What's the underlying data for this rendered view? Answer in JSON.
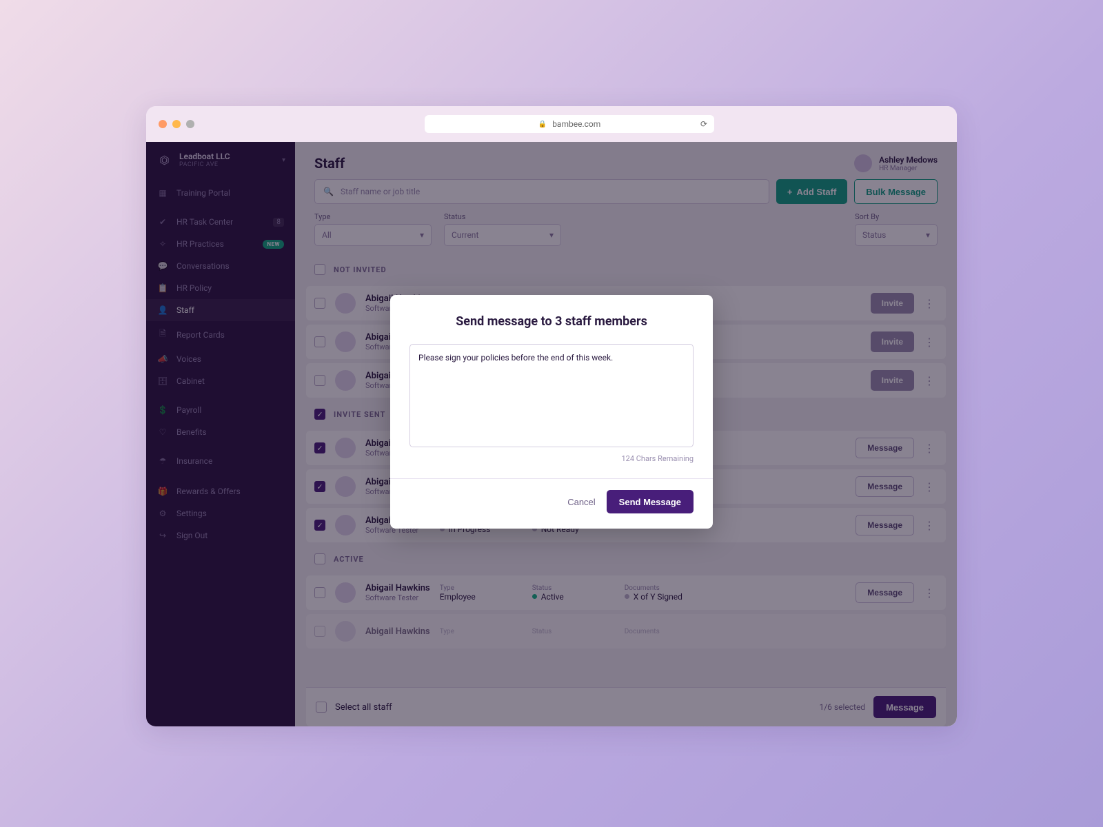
{
  "browser": {
    "url": "bambee.com"
  },
  "org": {
    "name": "Leadboat LLC",
    "sub": "PACIFIC AVE"
  },
  "nav": {
    "training": "Training Portal",
    "taskcenter": "HR Task Center",
    "taskcenter_badge": "8",
    "practices": "HR Practices",
    "practices_badge": "NEW",
    "conversations": "Conversations",
    "policy": "HR Policy",
    "staff": "Staff",
    "reportcards": "Report Cards",
    "voices": "Voices",
    "cabinet": "Cabinet",
    "payroll": "Payroll",
    "benefits": "Benefits",
    "insurance": "Insurance",
    "rewards": "Rewards & Offers",
    "settings": "Settings",
    "signout": "Sign Out"
  },
  "header": {
    "title": "Staff",
    "user_name": "Ashley Medows",
    "user_role": "HR Manager"
  },
  "toolbar": {
    "search_placeholder": "Staff name or job title",
    "add_staff": "Add Staff",
    "bulk_message": "Bulk Message"
  },
  "filters": {
    "type_label": "Type",
    "type_value": "All",
    "status_label": "Status",
    "status_value": "Current",
    "sort_label": "Sort By",
    "sort_value": "Status"
  },
  "sections": {
    "not_invited": "NOT INVITED",
    "invite_sent": "INVITE SENT",
    "active": "ACTIVE"
  },
  "labels": {
    "status": "Status",
    "documents": "Documents",
    "type": "Type",
    "invite": "Invite",
    "message": "Message",
    "in_progress": "In Progress",
    "not_ready": "Not Ready",
    "employee": "Employee",
    "active_val": "Active",
    "signed": "X of Y Signed"
  },
  "staff": {
    "name": "Abigail Hawkins",
    "title": "Software Tester"
  },
  "footer": {
    "select_all": "Select all staff",
    "count": "1/6 selected",
    "message": "Message"
  },
  "modal": {
    "title": "Send message to 3 staff members",
    "body": "Please sign your policies before the end of this week.",
    "counter": "124 Chars Remaining",
    "cancel": "Cancel",
    "send": "Send Message"
  }
}
